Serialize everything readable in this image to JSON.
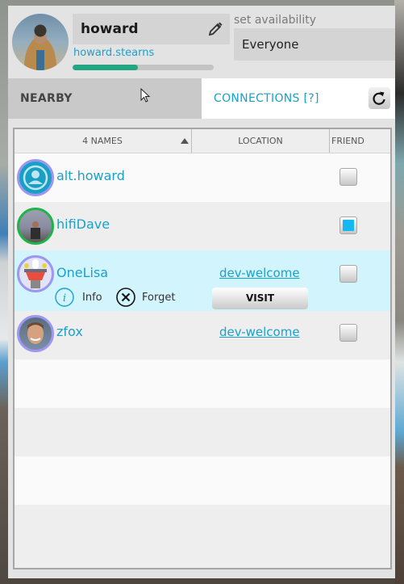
{
  "header": {
    "display_name": "howard",
    "username": "howard.stearns",
    "progress_percent": 46,
    "availability_label": "set availability",
    "availability_value": "Everyone"
  },
  "tabs": {
    "nearby": "NEARBY",
    "connections": "CONNECTIONS",
    "connections_help": "[?]",
    "active": "connections"
  },
  "table": {
    "columns": {
      "names": "4 NAMES",
      "location": "LOCATION",
      "friend": "FRIEND"
    },
    "sort_direction": "ascending",
    "rows": [
      {
        "name": "alt.howard",
        "location": "",
        "friend": false,
        "avatar": "default-user-icon"
      },
      {
        "name": "hifiDave",
        "location": "",
        "friend": true,
        "avatar": "photo",
        "presence_color": "#21b24a"
      },
      {
        "name": "OneLisa",
        "location": "dev-welcome",
        "friend": false,
        "avatar": "robot",
        "selected": true,
        "actions": {
          "info": "Info",
          "forget": "Forget",
          "visit": "VISIT"
        }
      },
      {
        "name": "zfox",
        "location": "dev-welcome",
        "friend": false,
        "avatar": "photo"
      }
    ]
  },
  "colors": {
    "accent": "#1ba0cc",
    "progress": "#24a682",
    "selected_row": "#d2f4fd",
    "checkbox_checked": "#17b7f2",
    "avatar_ring": "#9c97f3"
  }
}
